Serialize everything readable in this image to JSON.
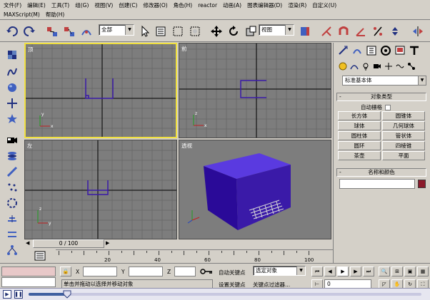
{
  "menu": {
    "row1": [
      "文件(F)",
      "编辑(E)",
      "工具(T)",
      "组(G)",
      "视图(V)",
      "创建(C)",
      "修改器(O)",
      "角色(H)",
      "reactor",
      "动画(A)",
      "图表编辑器(D)",
      "渲染(R)",
      "自定义(U)"
    ],
    "row2": [
      "MAXScript(M)",
      "帮助(H)"
    ]
  },
  "toolbar": {
    "selection_filter": "全部",
    "coord_system": "视图"
  },
  "viewports": {
    "top": "顶",
    "front": "前",
    "left": "左",
    "perspective": "透视"
  },
  "command_panel": {
    "category": "标准基本体",
    "object_type_header": "对象类型",
    "autogrid_label": "自动栅格",
    "buttons": [
      "长方体",
      "圆锥体",
      "球体",
      "几何球体",
      "圆柱体",
      "管状体",
      "圆环",
      "四棱锥",
      "茶壶",
      "平面"
    ],
    "name_color_header": "名称和颜色",
    "name_color": "#8b1a2b"
  },
  "timeline": {
    "frame_display": "0 / 100",
    "ticks": [
      0,
      10,
      20,
      30,
      40,
      50,
      60,
      70,
      80,
      90,
      100
    ],
    "tick_labels": [
      "20",
      "40",
      "60",
      "80",
      "100"
    ]
  },
  "status": {
    "x_label": "X",
    "y_label": "Y",
    "z_label": "Z",
    "prompt": "单击并拖动以选择并移动对象",
    "auto_key": "自动关键点",
    "set_key": "设置关键点",
    "selected": "选定对象",
    "key_filters": "关键点过滤器...",
    "frame": "0"
  },
  "colors": {
    "viewport_bg": "#7d7d7d",
    "active_border": "#f0e040",
    "box": "#3a1aa8"
  }
}
